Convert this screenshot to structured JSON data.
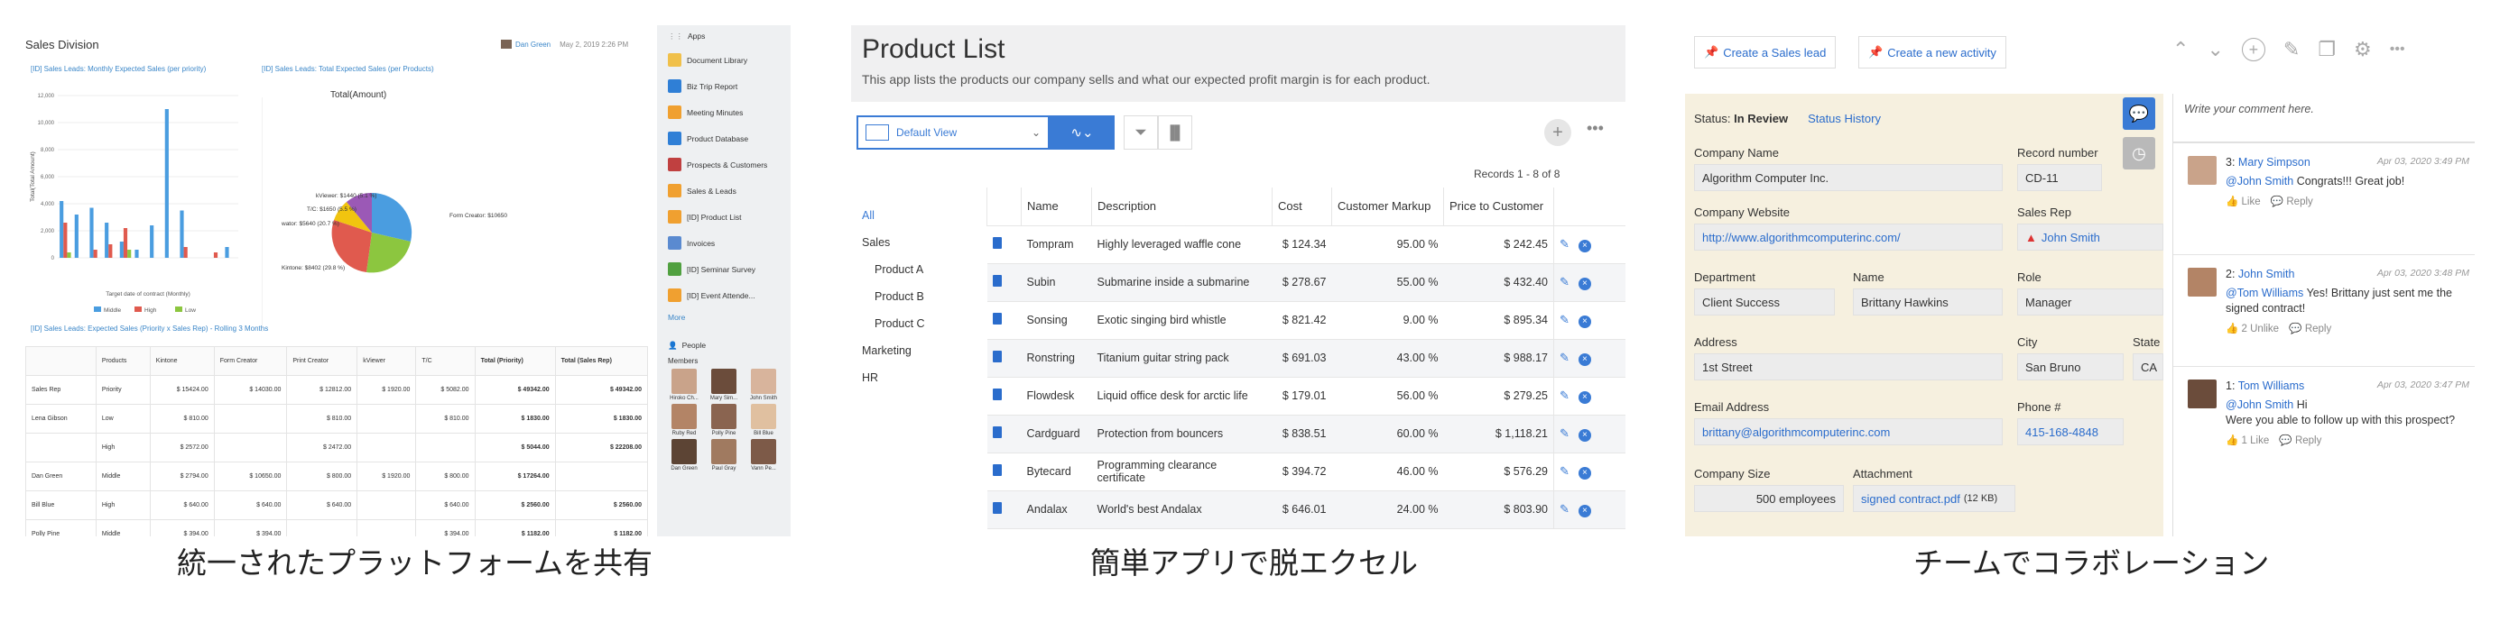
{
  "panel1": {
    "title": "Sales Division",
    "user": "Dan Green",
    "date": "May 2, 2019 2:26 PM",
    "chart1_title": "[ID] Sales Leads: Monthly Expected Sales (per priority)",
    "chart2_title": "[ID] Sales Leads: Total Expected Sales (per Products)",
    "chart2_heading": "Total(Amount)",
    "chart1_xlabel": "Target date of contract (Monthly)",
    "chart1_ylabel": "Total(Total Amount)",
    "legend": [
      "Middle",
      "High",
      "Low"
    ],
    "pie_labels": [
      "kViewer: $1440 (5.1 %)",
      "T/C: $1650 (5.5 %)",
      "wator: $5640 (20.7 %)",
      "Form Creator: $10650",
      "Kintone: $8402 (29.8 %)"
    ],
    "table_title": "[ID] Sales Leads: Expected Sales (Priority x Sales Rep) - Rolling 3 Months",
    "table_headers": [
      "",
      "Products",
      "Kintone",
      "Form Creator",
      "Print Creator",
      "kViewer",
      "T/C",
      "Total (Priority)",
      "Total (Sales Rep)"
    ],
    "table_rows": [
      [
        "Sales Rep",
        "Priority",
        "$ 15424.00",
        "$ 14030.00",
        "$ 12812.00",
        "$ 1920.00",
        "$ 5082.00",
        "$ 49342.00",
        "$ 49342.00"
      ],
      [
        "Lena Gibson",
        "Low",
        "$ 810.00",
        "",
        "$ 810.00",
        "",
        "$ 810.00",
        "$ 1830.00",
        "$ 1830.00"
      ],
      [
        "",
        "High",
        "$ 2572.00",
        "",
        "$ 2472.00",
        "",
        "",
        "$ 5044.00",
        "$ 22208.00"
      ],
      [
        "Dan Green",
        "Middle",
        "$ 2794.00",
        "$ 10650.00",
        "$ 800.00",
        "$ 1920.00",
        "$ 800.00",
        "$ 17264.00",
        ""
      ],
      [
        "Bill Blue",
        "High",
        "$ 640.00",
        "$ 640.00",
        "$ 640.00",
        "",
        "$ 640.00",
        "$ 2560.00",
        "$ 2560.00"
      ],
      [
        "Polly Pine",
        "Middle",
        "$ 394.00",
        "$ 394.00",
        "",
        "",
        "$ 394.00",
        "$ 1182.00",
        "$ 1182.00"
      ]
    ],
    "sidebar": {
      "apps_label": "Apps",
      "apps": [
        "Document Library",
        "Biz Trip Report",
        "Meeting Minutes",
        "Product Database",
        "Prospects & Customers",
        "Sales & Leads",
        "[ID] Product List",
        "Invoices",
        "[ID] Seminar Survey",
        "[ID] Event Attende..."
      ],
      "more": "More",
      "people": "People",
      "members": "Members",
      "member_names": [
        "Hiroko Ch...",
        "Mary Sim...",
        "John Smith",
        "Ruby Red",
        "Polly Pine",
        "Bill Blue",
        "Dan Green",
        "Paul Gray",
        "Vann Pe..."
      ]
    },
    "caption": "統一されたプラットフォームを共有"
  },
  "chart_data": {
    "type": "bar",
    "title": "[ID] Sales Leads: Monthly Expected Sales (per priority)",
    "xlabel": "Target date of contract (Monthly)",
    "ylabel": "Total(Total Amount)",
    "ylim": [
      0,
      12000
    ],
    "yticks": [
      "12,000",
      "10,000",
      "8,000",
      "6,000",
      "4,000",
      "2,000",
      "0"
    ],
    "series": [
      {
        "name": "Middle",
        "color": "#4a9de0",
        "values": [
          4200,
          3200,
          3700,
          2600,
          1200,
          600,
          2400,
          11000,
          3500,
          0,
          0,
          800
        ]
      },
      {
        "name": "High",
        "color": "#e05a4e",
        "values": [
          2600,
          0,
          600,
          1000,
          2200,
          0,
          0,
          0,
          800,
          0,
          400,
          0
        ]
      },
      {
        "name": "Low",
        "color": "#8cc63f",
        "values": [
          400,
          0,
          0,
          0,
          600,
          0,
          0,
          0,
          0,
          0,
          0,
          0
        ]
      }
    ]
  },
  "panel2": {
    "title": "Product List",
    "subtitle": "This app lists the products our company sells and what our expected profit margin is for each product.",
    "view": "Default View",
    "records": "Records 1 - 8 of 8",
    "categories": [
      "All",
      "Sales",
      "Product A",
      "Product B",
      "Product C",
      "Marketing",
      "HR"
    ],
    "headers": [
      "Name",
      "Description",
      "Cost",
      "Customer Markup",
      "Price to Customer"
    ],
    "rows": [
      [
        "Tompram",
        "Highly leveraged waffle cone",
        "$ 124.34",
        "95.00 %",
        "$ 242.45"
      ],
      [
        "Subin",
        "Submarine inside a submarine",
        "$ 278.67",
        "55.00 %",
        "$ 432.40"
      ],
      [
        "Sonsing",
        "Exotic singing bird whistle",
        "$ 821.42",
        "9.00 %",
        "$ 895.34"
      ],
      [
        "Ronstring",
        "Titanium guitar string pack",
        "$ 691.03",
        "43.00 %",
        "$ 988.17"
      ],
      [
        "Flowdesk",
        "Liquid office desk for arctic life",
        "$ 179.01",
        "56.00 %",
        "$ 279.25"
      ],
      [
        "Cardguard",
        "Protection from bouncers",
        "$ 838.51",
        "60.00 %",
        "$ 1,118.21"
      ],
      [
        "Bytecard",
        "Programming clearance certificate",
        "$ 394.72",
        "46.00 %",
        "$ 576.29"
      ],
      [
        "Andalax",
        "World's best Andalax",
        "$ 646.01",
        "24.00 %",
        "$ 803.90"
      ]
    ],
    "caption": "簡単アプリで脱エクセル"
  },
  "panel3": {
    "btn_lead": "Create a Sales lead",
    "btn_activity": "Create a new activity",
    "status_label": "Status:",
    "status_value": "In Review",
    "status_history": "Status History",
    "fields": {
      "company_name_l": "Company Name",
      "company_name": "Algorithm Computer Inc.",
      "record_l": "Record number",
      "record": "CD-11",
      "website_l": "Company Website",
      "website": "http://www.algorithmcomputerinc.com/",
      "rep_l": "Sales Rep",
      "rep": "John Smith",
      "dept_l": "Department",
      "dept": "Client Success",
      "name_l": "Name",
      "name": "Brittany Hawkins",
      "role_l": "Role",
      "role": "Manager",
      "addr_l": "Address",
      "addr": "1st Street",
      "city_l": "City",
      "city": "San Bruno",
      "state_l": "State",
      "state": "CA",
      "email_l": "Email Address",
      "email": "brittany@algorithmcomputerinc.com",
      "phone_l": "Phone #",
      "phone": "415-168-4848",
      "size_l": "Company Size",
      "size": "500 employees",
      "attach_l": "Attachment",
      "attach": "signed contract.pdf",
      "attach_size": "(12 KB)"
    },
    "comment_placeholder": "Write your comment here.",
    "comments": [
      {
        "num": "3:",
        "author": "Mary Simpson",
        "date": "Apr 03, 2020 3:49 PM",
        "mention": "@John Smith",
        "text": "Congrats!!! Great job!",
        "like": "Like",
        "reply": "Reply"
      },
      {
        "num": "2:",
        "author": "John Smith",
        "date": "Apr 03, 2020 3:48 PM",
        "mention": "@Tom Williams",
        "text": "Yes! Brittany just sent me the signed contract!",
        "like": "2  Unlike",
        "reply": "Reply"
      },
      {
        "num": "1:",
        "author": "Tom Williams",
        "date": "Apr 03, 2020 3:47 PM",
        "mention": "@John Smith",
        "text": "Hi",
        "text2": "Were you able to follow up with this prospect?",
        "like": "1  Like",
        "reply": "Reply"
      }
    ],
    "caption": "チームでコラボレーション"
  }
}
